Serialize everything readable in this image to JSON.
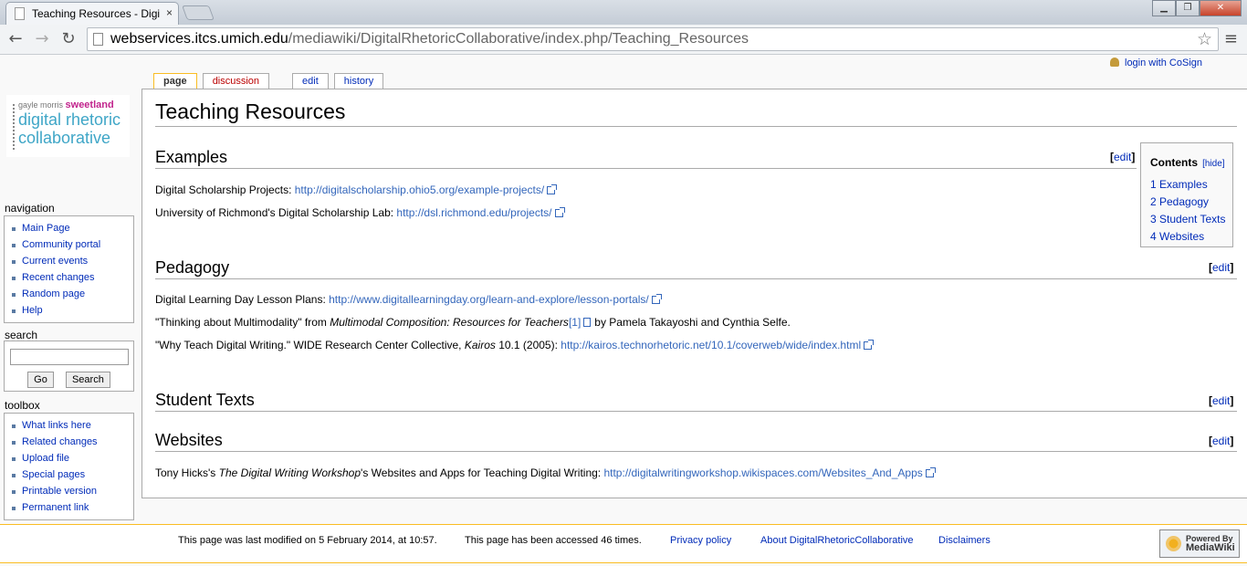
{
  "browser": {
    "tab_title": "Teaching Resources - Digi",
    "tab_close": "×",
    "url_host": "webservices.itcs.umich.edu",
    "url_path": "/mediawiki/DigitalRhetoricCollaborative/index.php/Teaching_Resources",
    "min": "▁",
    "max": "❐",
    "close": "✕",
    "back": "←",
    "forward": "→",
    "reload": "↻",
    "star": "☆",
    "menu": "≡"
  },
  "logo": {
    "line1a": "gayle morris ",
    "line1b": "sweetland",
    "line2": "digital rhetoric",
    "line3": "collaborative"
  },
  "sidebar": {
    "navigation_title": "navigation",
    "navigation": [
      "Main Page",
      "Community portal",
      "Current events",
      "Recent changes",
      "Random page",
      "Help"
    ],
    "search_title": "search",
    "go_label": "Go",
    "search_label": "Search",
    "toolbox_title": "toolbox",
    "toolbox": [
      "What links here",
      "Related changes",
      "Upload file",
      "Special pages",
      "Printable version",
      "Permanent link"
    ]
  },
  "tabs": {
    "page": "page",
    "discussion": "discussion",
    "edit": "edit",
    "history": "history"
  },
  "login": "login with CoSign",
  "content": {
    "title": "Teaching Resources",
    "edit_open": "[",
    "edit_label": "edit",
    "edit_close": "]",
    "sections": {
      "examples": "Examples",
      "pedagogy": "Pedagogy",
      "student_texts": "Student Texts",
      "websites": "Websites"
    },
    "ex1_text": "Digital Scholarship Projects: ",
    "ex1_link": "http://digitalscholarship.ohio5.org/example-projects/",
    "ex2_text": "University of Richmond's Digital Scholarship Lab: ",
    "ex2_link": "http://dsl.richmond.edu/projects/",
    "ped1_text": "Digital Learning Day Lesson Plans: ",
    "ped1_link": "http://www.digitallearningday.org/learn-and-explore/lesson-portals/",
    "ped2_a": "\"Thinking about Multimodality\" from ",
    "ped2_em": "Multimodal Composition: Resources for Teachers",
    "ped2_ref": "[1]",
    "ped2_b": "by Pamela Takayoshi and Cynthia Selfe.",
    "ped3_a": "\"Why Teach Digital Writing.\" WIDE Research Center Collective, ",
    "ped3_em": "Kairos",
    "ped3_b": " 10.1 (2005): ",
    "ped3_link": "http://kairos.technorhetoric.net/10.1/coverweb/wide/index.html",
    "web1_a": "Tony Hicks's ",
    "web1_em": "The Digital Writing Workshop",
    "web1_b": "'s Websites and Apps for Teaching Digital Writing: ",
    "web1_link": "http://digitalwritingworkshop.wikispaces.com/Websites_And_Apps"
  },
  "toc": {
    "title": "Contents",
    "hide": "[hide]",
    "items": [
      "1 Examples",
      "2 Pedagogy",
      "3 Student Texts",
      "4 Websites"
    ]
  },
  "footer": {
    "modified": "This page was last modified on 5 February 2014, at 10:57.",
    "accessed": "This page has been accessed 46 times.",
    "privacy": "Privacy policy",
    "about": "About DigitalRhetoricCollaborative",
    "disclaimers": "Disclaimers",
    "powered_1": "Powered By",
    "powered_2": "MediaWiki"
  }
}
